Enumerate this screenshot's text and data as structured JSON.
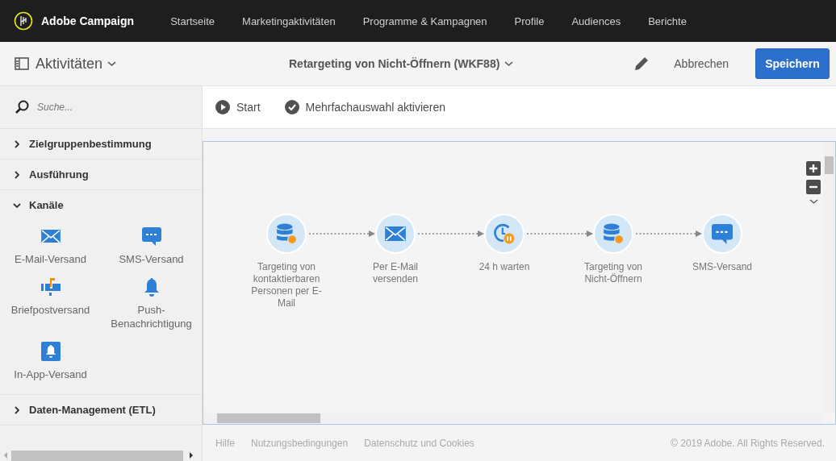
{
  "app": {
    "name": "Adobe Campaign"
  },
  "nav": [
    "Startseite",
    "Marketingaktivitäten",
    "Programme & Kampagnen",
    "Profile",
    "Audiences",
    "Berichte"
  ],
  "header": {
    "panel_title": "Aktivitäten",
    "workflow_title": "Retargeting von Nicht-Öffnern (WKF88)",
    "cancel": "Abbrechen",
    "save": "Speichern"
  },
  "sidebar": {
    "search": {
      "placeholder": "Suche..."
    },
    "groups": [
      {
        "label": "Zielgruppenbestimmung",
        "expanded": false
      },
      {
        "label": "Ausführung",
        "expanded": false
      },
      {
        "label": "Kanäle",
        "expanded": true,
        "items": [
          {
            "label": "E-Mail-Versand",
            "kind": "email"
          },
          {
            "label": "SMS-Versand",
            "kind": "sms"
          },
          {
            "label": "Briefpostversand",
            "kind": "mailbox"
          },
          {
            "label": "Push-Benachrichtigung",
            "kind": "push"
          },
          {
            "label": "In-App-Versand",
            "kind": "inapp"
          }
        ]
      },
      {
        "label": "Daten-Management (ETL)",
        "expanded": false
      }
    ]
  },
  "toolbar": {
    "start": "Start",
    "multiselect": "Mehrfachauswahl aktivieren"
  },
  "workflow": {
    "nodes": [
      {
        "label": "Targeting von kontaktierbaren Personen per E-Mail",
        "kind": "targeting"
      },
      {
        "label": "Per E-Mail versenden",
        "kind": "email"
      },
      {
        "label": "24 h warten",
        "kind": "wait"
      },
      {
        "label": "Targeting von Nicht-Öffnern",
        "kind": "targeting"
      },
      {
        "label": "SMS-Versand",
        "kind": "sms"
      }
    ]
  },
  "footer": {
    "links": [
      "Hilfe",
      "Nutzungsbedingungen",
      "Datenschutz und Cookies"
    ],
    "copyright": "© 2019 Adobe. All Rights Reserved."
  }
}
